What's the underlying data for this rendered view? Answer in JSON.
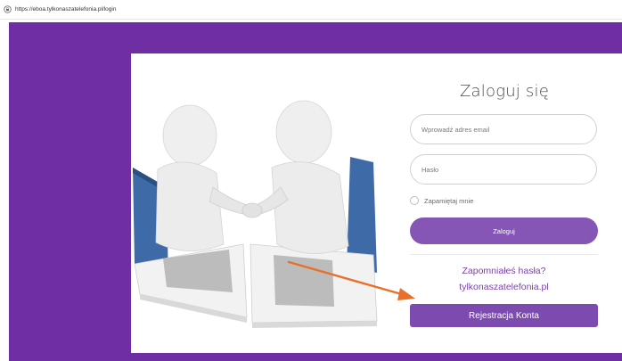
{
  "browser": {
    "url": "https://eboa.tylkonaszatelefonia.pl/login"
  },
  "colors": {
    "background": "#6f2ea3",
    "button": "#8556b5",
    "register_button": "#7d4ab0",
    "link": "#7a44a8",
    "arrow": "#e8702a"
  },
  "login": {
    "title": "Zaloguj się",
    "email_placeholder": "Wprowadź adres email",
    "password_placeholder": "Hasło",
    "remember_label": "Zapamiętaj mnie",
    "login_button": "Zaloguj",
    "forgot_link": "Zapomniałeś hasła?",
    "site_link": "tylkonaszatelefonia.pl",
    "register_button": "Rejestracja Konta"
  },
  "icons": {
    "lock": "lock-icon",
    "illustration": "handshake-laptops-illustration",
    "arrow": "arrow-icon"
  }
}
